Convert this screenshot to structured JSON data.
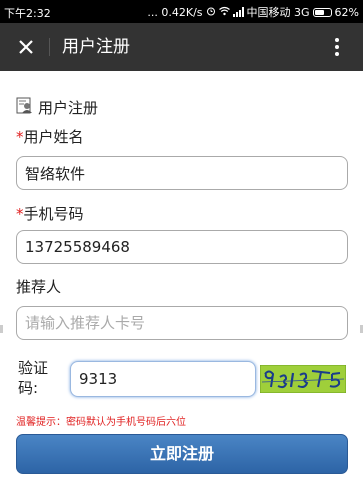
{
  "status_bar": {
    "time": "下午2:32",
    "net_speed": "... 0.42K/s",
    "carrier": "中国移动 3G",
    "battery_percent": "62%",
    "battery_level": 0.62
  },
  "app_bar": {
    "title": "用户注册"
  },
  "form": {
    "title": "用户注册",
    "name": {
      "required_mark": "*",
      "label": "用户姓名",
      "value": "智络软件"
    },
    "phone": {
      "required_mark": "*",
      "label": "手机号码",
      "value": "13725589468"
    },
    "referrer": {
      "label": "推荐人",
      "placeholder": "请输入推荐人卡号"
    },
    "captcha": {
      "label": "验证码:",
      "value": "9313"
    },
    "hint": "温馨提示：密码默认为手机号码后六位",
    "submit_label": "立即注册"
  },
  "icons": [
    "close-icon",
    "more-icon",
    "user-form-icon",
    "wifi-icon",
    "signal-icon",
    "battery-icon",
    "alarm-icon"
  ]
}
